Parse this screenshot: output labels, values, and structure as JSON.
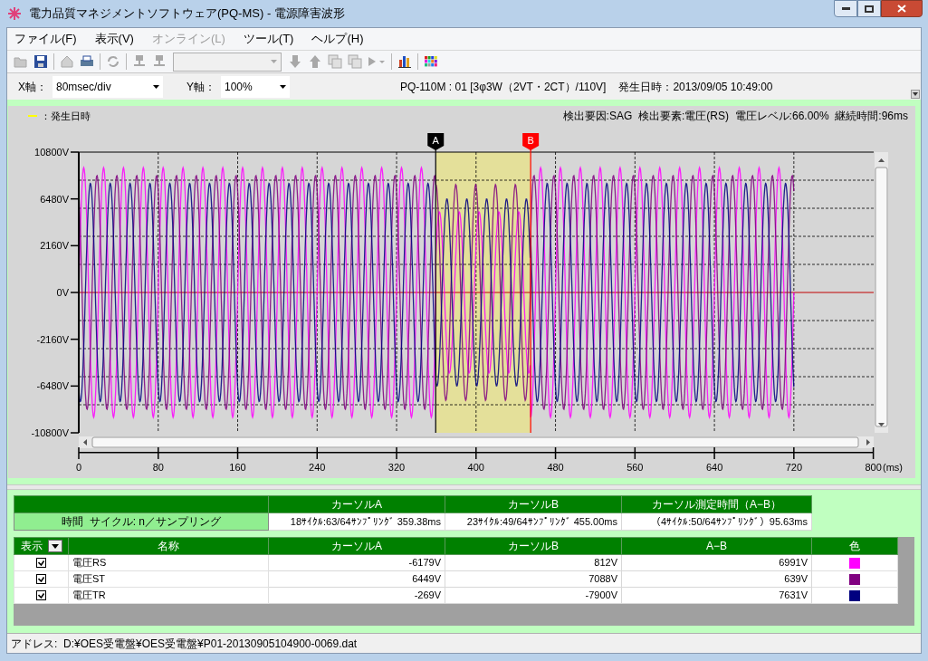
{
  "window": {
    "title": "電力品質マネジメントソフトウェア(PQ-MS) - 電源障害波形"
  },
  "menu": [
    {
      "label": "ファイル(F)",
      "disabled": false
    },
    {
      "label": "表示(V)",
      "disabled": false
    },
    {
      "label": "オンライン(L)",
      "disabled": true
    },
    {
      "label": "ツール(T)",
      "disabled": false
    },
    {
      "label": "ヘルプ(H)",
      "disabled": false
    }
  ],
  "toolbar": [
    {
      "kind": "open",
      "disabled": true
    },
    {
      "kind": "save",
      "disabled": false
    },
    {
      "kind": "sep"
    },
    {
      "kind": "home",
      "disabled": true
    },
    {
      "kind": "print",
      "disabled": false
    },
    {
      "kind": "sep"
    },
    {
      "kind": "refresh",
      "disabled": true
    },
    {
      "kind": "sep"
    },
    {
      "kind": "net",
      "disabled": true
    },
    {
      "kind": "net",
      "disabled": true
    },
    {
      "kind": "combo",
      "disabled": true
    },
    {
      "kind": "down",
      "disabled": true
    },
    {
      "kind": "up",
      "disabled": true
    },
    {
      "kind": "pages",
      "disabled": true
    },
    {
      "kind": "pages",
      "disabled": true
    },
    {
      "kind": "play",
      "disabled": true
    },
    {
      "kind": "sep"
    },
    {
      "kind": "bars",
      "disabled": false
    },
    {
      "kind": "sep"
    },
    {
      "kind": "palette",
      "disabled": false
    }
  ],
  "axis_bar": {
    "x_label": "X軸：",
    "x_value": "80msec/div",
    "y_label": "Y軸：",
    "y_value": "100%",
    "device": "PQ-110M : 01 [3φ3W（2VT・2CT）/110V]",
    "occurred": "発生日時：2013/09/05 10:49:00"
  },
  "chart": {
    "legend": "：発生日時",
    "detection": "検出要因:SAG  検出要素:電圧(RS)  電圧レベル:66.00%  継続時間:96ms",
    "y_ticks": [
      "10800V",
      "6480V",
      "2160V",
      "0V",
      "-2160V",
      "-6480V",
      "-10800V"
    ],
    "x_ticks": [
      "0",
      "80",
      "160",
      "240",
      "320",
      "400",
      "480",
      "560",
      "640",
      "720",
      "800"
    ],
    "x_unit": "(ms)",
    "cursors": [
      {
        "label": "A",
        "color": "#000000"
      },
      {
        "label": "B",
        "color": "#ff0000"
      }
    ]
  },
  "cursor_table": {
    "columns": [
      "カーソルA",
      "カーソルB",
      "カーソル測定時間（A−B）"
    ],
    "row_label": "時間  サイクル: n／サンプリング",
    "cells": [
      "18ｻｲｸﾙ:63/64ｻﾝﾌﾟﾘﾝｸﾞ 359.38ms",
      "23ｻｲｸﾙ:49/64ｻﾝﾌﾟﾘﾝｸﾞ 455.00ms",
      "（4ｻｲｸﾙ:50/64ｻﾝﾌﾟﾘﾝｸﾞ）95.63ms"
    ]
  },
  "channel_table": {
    "columns": [
      "表示",
      "名称",
      "カーソルA",
      "カーソルB",
      "A−B",
      "色"
    ],
    "rows": [
      {
        "checked": true,
        "name": "電圧RS",
        "a": "-6179V",
        "b": "812V",
        "ab": "6991V",
        "color": "#ff00ff"
      },
      {
        "checked": true,
        "name": "電圧ST",
        "a": "6449V",
        "b": "7088V",
        "ab": "639V",
        "color": "#800080"
      },
      {
        "checked": true,
        "name": "電圧TR",
        "a": "-269V",
        "b": "-7900V",
        "ab": "7631V",
        "color": "#000080"
      }
    ]
  },
  "status_bar": "アドレス:  D:¥OES受電盤¥OES受電盤¥P01-20130905104900-0069.dat"
}
